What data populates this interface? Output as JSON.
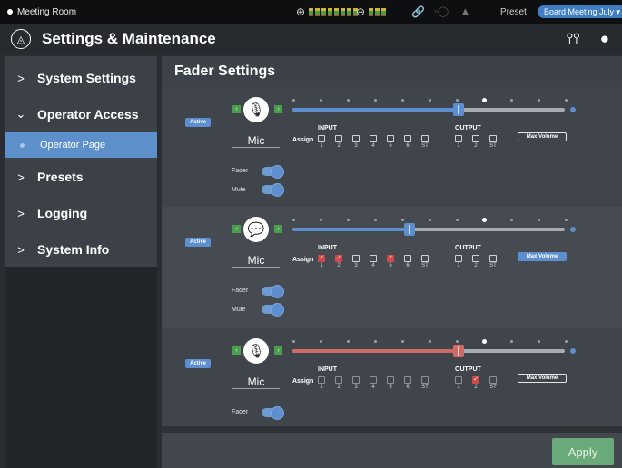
{
  "status": {
    "room": "Meeting Room",
    "preset_label": "Preset",
    "preset_value": "Board Meeting July ▾"
  },
  "header": {
    "title": "Settings & Maintenance"
  },
  "sidebar": {
    "items": [
      {
        "label": "System Settings",
        "chevron": ">"
      },
      {
        "label": "Operator Access",
        "chevron": "⌄"
      },
      {
        "label": "Operator Page"
      },
      {
        "label": "Presets",
        "chevron": ">"
      },
      {
        "label": "Logging",
        "chevron": ">"
      },
      {
        "label": "System Info",
        "chevron": ">"
      }
    ]
  },
  "main": {
    "title": "Fader Settings",
    "input_label": "INPUT",
    "output_label": "OUTPUT",
    "assign_label": "Assign",
    "input_numbers": [
      "1",
      "2",
      "3",
      "4",
      "5",
      "6",
      "ST"
    ],
    "output_numbers": [
      "1",
      "2",
      "ST"
    ],
    "fader_label": "Fader",
    "mute_label": "Mute",
    "active_label": "Active",
    "max_volume_label": "Max Volume",
    "channels": [
      {
        "name": "Mic",
        "icon": "microphone-icon",
        "level": 0.61,
        "fill_color": "#5c8ed0",
        "inputs_on": [],
        "outputs_on": [],
        "max_volume_on": false
      },
      {
        "name": "Mic",
        "icon": "speech-bubble-icon",
        "level": 0.43,
        "fill_color": "#5c8ed0",
        "inputs_on": [
          1,
          2,
          5
        ],
        "outputs_on": [],
        "max_volume_on": true
      },
      {
        "name": "Mic",
        "icon": "microphone-icon",
        "level": 0.61,
        "fill_color": "#d06a65",
        "inputs_on": [],
        "outputs_on": [
          2
        ],
        "max_volume_on": false
      }
    ]
  },
  "footer": {
    "apply_label": "Apply"
  },
  "colors": {
    "accent": "#5c8ed0",
    "apply": "#6aa97a",
    "muted_red": "#d06a65"
  }
}
